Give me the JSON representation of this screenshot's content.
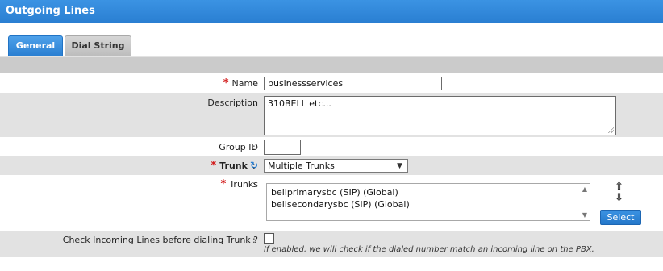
{
  "window": {
    "title": "Outgoing Lines"
  },
  "tabs": [
    {
      "label": "General",
      "active": true
    },
    {
      "label": "Dial String",
      "active": false
    }
  ],
  "form": {
    "name": {
      "label": "Name",
      "required": true,
      "value": "businessservices"
    },
    "description": {
      "label": "Description",
      "value": "310BELL etc..."
    },
    "group_id": {
      "label": "Group ID",
      "value": ""
    },
    "trunk": {
      "label": "Trunk",
      "required": true,
      "selected": "Multiple Trunks",
      "icon": "refresh-icon"
    },
    "trunks": {
      "label": "Trunks",
      "required": true,
      "items": [
        "bellprimarysbc (SIP) (Global)",
        "bellsecondarysbc (SIP) (Global)"
      ],
      "select_button": "Select"
    },
    "check_incoming": {
      "label": "Check Incoming Lines before dialing Trunk ?",
      "checked": false,
      "hint": "If enabled, we will check if the dialed number match an incoming line on the PBX."
    }
  },
  "colors": {
    "titlebar": "#2a7fd2",
    "required_asterisk": "#d21a1a",
    "row_dark": "#e2e2e2"
  }
}
